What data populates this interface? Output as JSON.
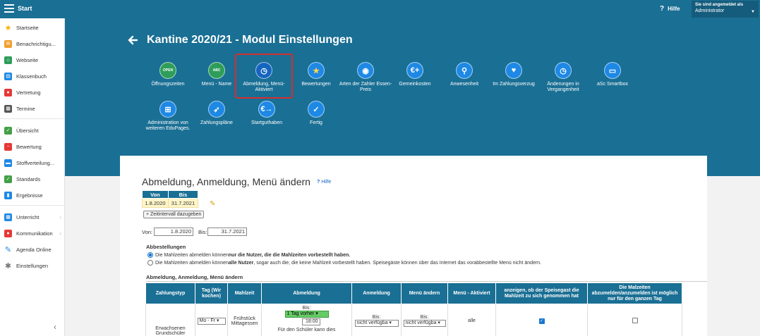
{
  "topbar": {
    "app": "Start",
    "help": "Hilfe",
    "account_line1": "Sie sind angemeldet als",
    "account_line2": "Administrator"
  },
  "sidebar": {
    "items": [
      {
        "label": "Startseite",
        "icon": "star-icon",
        "color": "#f5b400"
      },
      {
        "label": "Benachrichtigu...",
        "icon": "mail-icon",
        "color": "#f0a030"
      },
      {
        "label": "Webseite",
        "icon": "home-icon",
        "color": "#2e9d5a"
      },
      {
        "label": "Klassenbuch",
        "icon": "book-icon",
        "color": "#1e88e5"
      },
      {
        "label": "Vertretung",
        "icon": "person-icon",
        "color": "#e53935"
      },
      {
        "label": "Termine",
        "icon": "calendar-icon",
        "color": "#555555"
      },
      {
        "label": "Übersicht",
        "icon": "check-circle-icon",
        "color": "#43a047"
      },
      {
        "label": "Bewertung",
        "icon": "minus-circle-icon",
        "color": "#e53935"
      },
      {
        "label": "Stoffverteilung...",
        "icon": "folder-icon",
        "color": "#1e88e5"
      },
      {
        "label": "Standards",
        "icon": "shield-icon",
        "color": "#43a047"
      },
      {
        "label": "Ergebnisse",
        "icon": "chart-icon",
        "color": "#1e88e5"
      },
      {
        "label": "Unterricht",
        "icon": "grid-icon",
        "color": "#1e88e5"
      },
      {
        "label": "Kommunikation",
        "icon": "chat-icon",
        "color": "#e53935"
      },
      {
        "label": "Agenda Online",
        "icon": "pen-icon",
        "color": "#1e88e5"
      },
      {
        "label": "Einstellungen",
        "icon": "gear-icon",
        "color": "#777777"
      }
    ]
  },
  "header": {
    "title": "Kantine 2020/21 - Modul Einstellungen"
  },
  "tiles": [
    {
      "label": "Öffnungszeiten",
      "icon": "open-sign-icon",
      "color": "#2e9d5a"
    },
    {
      "label": "Menü - Name",
      "icon": "abc-icon",
      "color": "#2e9d5a"
    },
    {
      "label": "Abmeldung, Menü-Aktiviert",
      "icon": "clock-icon",
      "color": "#1565c0"
    },
    {
      "label": "Bewertungen",
      "icon": "star-icon",
      "color": "#1e88e5"
    },
    {
      "label": "Arten der Zahler Essen-Preis",
      "icon": "payer-icon",
      "color": "#1e88e5"
    },
    {
      "label": "Gemeinkosten",
      "icon": "euro-plus-icon",
      "color": "#1e88e5"
    },
    {
      "label": "Anwesenheit",
      "icon": "walk-icon",
      "color": "#1e88e5"
    },
    {
      "label": "Im Zahlungsverzug",
      "icon": "piggy-icon",
      "color": "#1e88e5"
    },
    {
      "label": "Änderungen in Vergangenheit",
      "icon": "history-icon",
      "color": "#1e88e5"
    },
    {
      "label": "aSc Smartbox",
      "icon": "monitor-icon",
      "color": "#1e88e5"
    },
    {
      "label": "Administration von weiteren EduPages.",
      "icon": "org-icon",
      "color": "#1e88e5"
    },
    {
      "label": "Zahlungspläne",
      "icon": "rocket-icon",
      "color": "#1e88e5"
    },
    {
      "label": "Startguthaben",
      "icon": "euro-arrow-icon",
      "color": "#1e88e5"
    },
    {
      "label": "Fertig",
      "icon": "check-icon",
      "color": "#1e88e5"
    }
  ],
  "section": {
    "title": "Abmeldung, Anmeldung, Menü ändern",
    "hilfe": "Hilfe",
    "period_headers": {
      "von": "Von",
      "bis": "Bis"
    },
    "period_row": {
      "von": "1.8.2020",
      "bis": "31.7.2021"
    },
    "add_interval": "+ Zeitintervall dazugeben",
    "von_label": "Von:",
    "von_value": "1.8.2020",
    "bis_label": "Bis:",
    "bis_value": "31.7.2021",
    "abbestellungen": "Abbestellungen",
    "radio1_a": "Die Mahlzeiten abmelden können ",
    "radio1_b": "nur die Nutzer, die die Mahlzeiten vorbestellt haben.",
    "radio2_a": "Die Mahlzeiten abmelden können ",
    "radio2_b": "alle Nutzer",
    "radio2_c": ", sogar auch die, die keine Mahlzeit vorbestellt haben. Speisegäste können über das Internet das vorabbestellte Menü nicht ändern.",
    "table_title": "Abmeldung, Anmeldung, Menü ändern"
  },
  "table": {
    "headers": [
      "Zahlungstyp",
      "Tag (Wir kochen)",
      "Mahlzeit",
      "Abmeldung",
      "Anmeldung",
      "Menü ändern",
      "Menü - Aktiviert",
      "anzeigen, ob der Speisegast die Mahlzeit zu sich genommen hat",
      "Die Malzeiten abzumelden/anzumelden ist möglich nur für den ganzen Tag"
    ],
    "row": {
      "zahlungstyp": "Erwachsenen Grundschüler",
      "tag": "Mo - Fr",
      "mahlzeit": "Frühstück Mittagessen",
      "abm_bis": "Bis:",
      "abm_select": "1 Tag vorher",
      "abm_time": "18:00",
      "abm_note": "Für den Schüler kann dies",
      "anm_bis": "Bis:",
      "anm_select": "nicht verfügba",
      "menu_bis": "Bis:",
      "menu_select": "nicht verfügba",
      "aktiviert": "alle"
    }
  }
}
